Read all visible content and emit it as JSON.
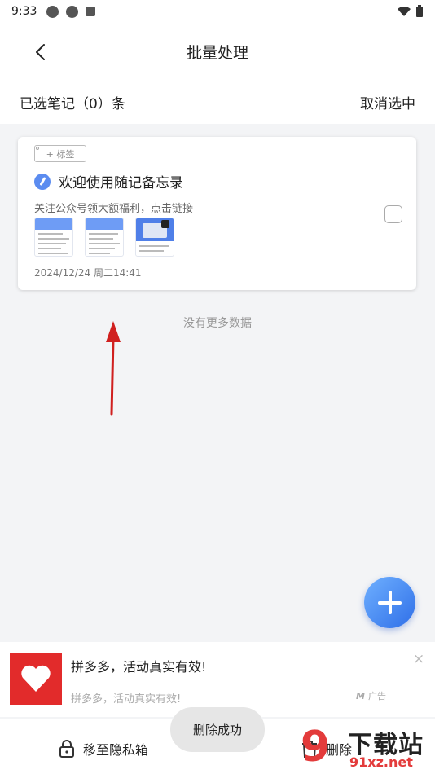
{
  "status": {
    "time": "9:33"
  },
  "nav": {
    "title": "批量处理"
  },
  "select_bar": {
    "selected_label": "已选笔记（0）条",
    "cancel_label": "取消选中"
  },
  "note": {
    "tag_label": "+ 标签",
    "title": "欢迎使用随记备忘录",
    "summary": "关注公众号领大额福利，点击链接",
    "date": "2024/12/24   周二14:41"
  },
  "list": {
    "no_more": "没有更多数据"
  },
  "ad": {
    "title": "拼多多，活动真实有效!",
    "subtitle": "拼多多，活动真实有效!",
    "close": "×",
    "label": "广告"
  },
  "bottom": {
    "private_label": "移至隐私箱",
    "delete_label": "删除"
  },
  "toast": {
    "text": "删除成功"
  },
  "watermark": {
    "logo": "9",
    "cn": "下载站",
    "url": "91xz.net"
  },
  "colors": {
    "accent": "#4f7fe8",
    "arrow": "#d0201f",
    "ad_red": "#e22b2b"
  }
}
